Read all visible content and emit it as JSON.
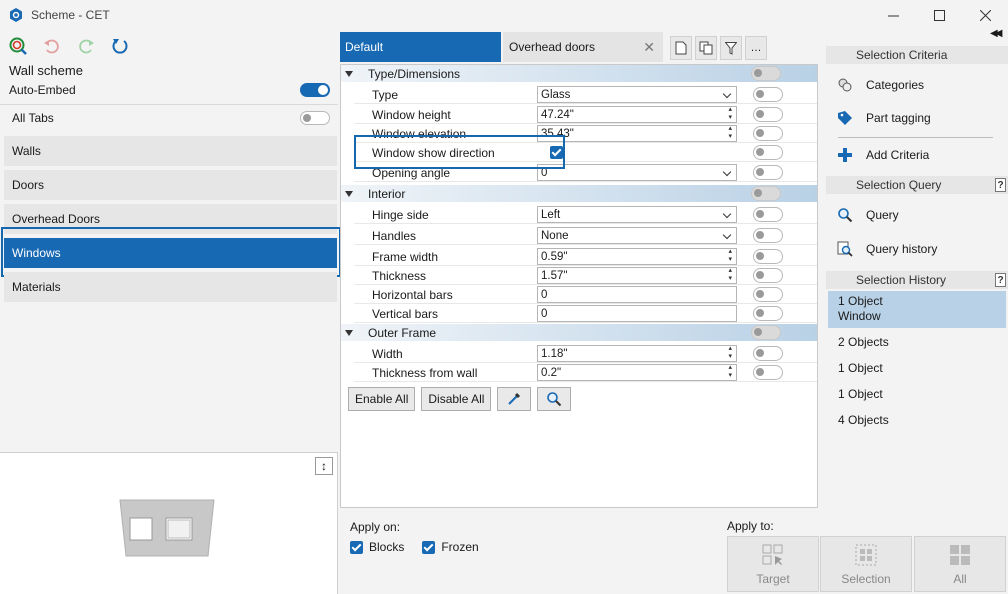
{
  "window": {
    "title": "Scheme - CET"
  },
  "left": {
    "wall_scheme": "Wall scheme",
    "auto_embed": "Auto-Embed",
    "all_tabs": "All Tabs",
    "tabs": [
      "Walls",
      "Doors",
      "Overhead Doors",
      "Windows",
      "Materials"
    ],
    "active_tab": "Windows"
  },
  "middle": {
    "tab_default": "Default",
    "tab_overhead": "Overhead doors",
    "groups": {
      "type_dim": "Type/Dimensions",
      "interior": "Interior",
      "outer_frame": "Outer Frame"
    },
    "rows": {
      "type": {
        "label": "Type",
        "value": "Glass"
      },
      "window_height": {
        "label": "Window height",
        "value": "47.24\""
      },
      "window_elevation": {
        "label": "Window elevation",
        "value": "35.43\""
      },
      "window_show_direction": {
        "label": "Window show direction"
      },
      "opening_angle": {
        "label": "Opening angle",
        "value": "0"
      },
      "hinge_side": {
        "label": "Hinge side",
        "value": "Left"
      },
      "handles": {
        "label": "Handles",
        "value": "None"
      },
      "frame_width": {
        "label": "Frame width",
        "value": "0.59\""
      },
      "thickness": {
        "label": "Thickness",
        "value": "1.57\""
      },
      "horizontal_bars": {
        "label": "Horizontal bars",
        "value": "0"
      },
      "vertical_bars": {
        "label": "Vertical bars",
        "value": "0"
      },
      "width": {
        "label": "Width",
        "value": "1.18\""
      },
      "thickness_from_wall": {
        "label": "Thickness from wall",
        "value": "0.2\""
      }
    },
    "enable_all": "Enable All",
    "disable_all": "Disable All",
    "apply_on": {
      "label": "Apply on:",
      "blocks": "Blocks",
      "frozen": "Frozen"
    },
    "apply_to": {
      "label": "Apply to:",
      "target": "Target",
      "selection": "Selection",
      "all": "All"
    }
  },
  "right": {
    "selection_criteria": "Selection Criteria",
    "categories": "Categories",
    "part_tagging": "Part tagging",
    "add_criteria": "Add Criteria",
    "selection_query": "Selection Query",
    "query": "Query",
    "query_history": "Query history",
    "selection_history": "Selection History",
    "history": [
      {
        "line1": "1 Object",
        "line2": "Window"
      },
      {
        "line1": "2 Objects"
      },
      {
        "line1": "1 Object"
      },
      {
        "line1": "1 Object"
      },
      {
        "line1": "4 Objects"
      }
    ]
  },
  "colors": {
    "accent": "#1769b3",
    "selected_history": "#b9d1e6"
  }
}
